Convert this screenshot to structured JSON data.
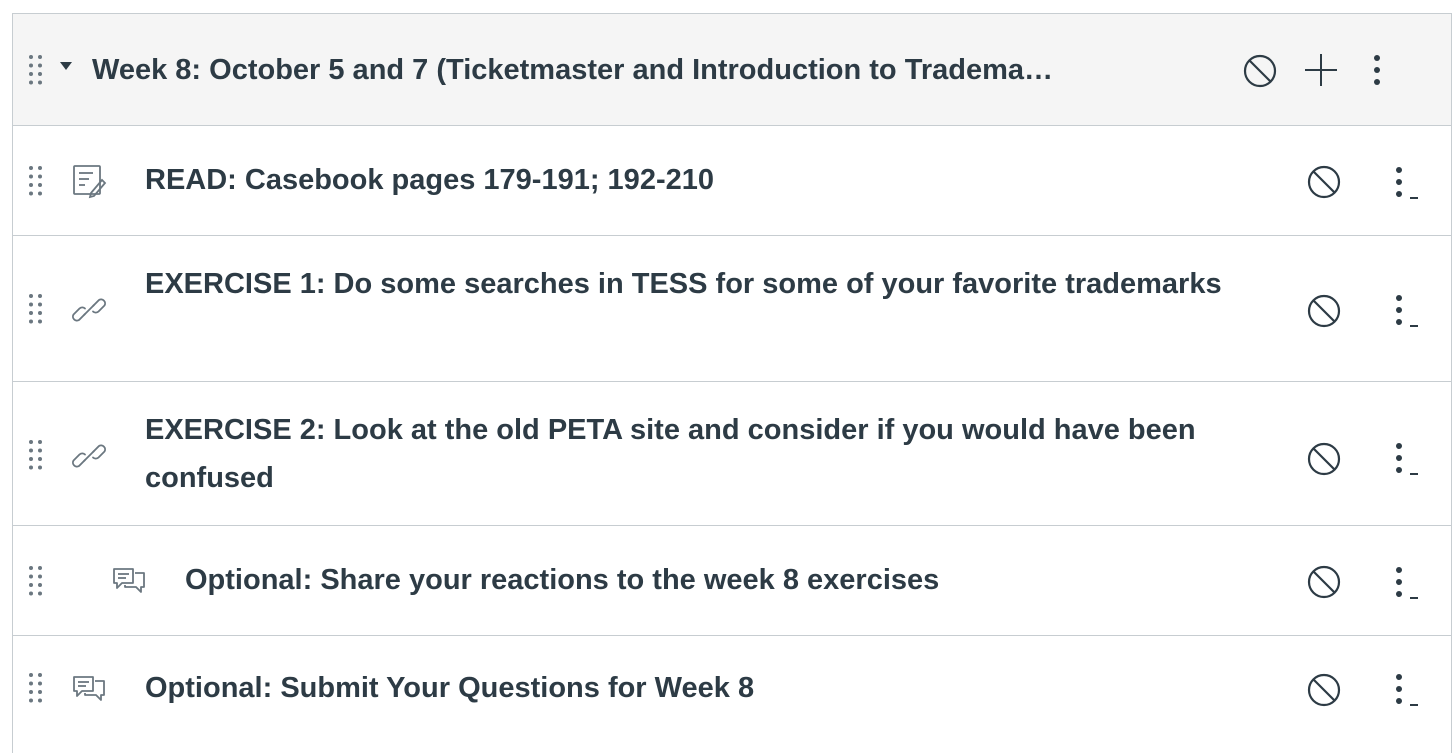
{
  "module": {
    "title": "Week 8: October 5 and 7 (Ticketmaster and Introduction to Tradema…"
  },
  "items": [
    {
      "title": "READ: Casebook pages 179-191; 192-210",
      "icon": "assignment-icon"
    },
    {
      "title": "EXERCISE 1: Do some searches in TESS for some of your favorite trademarks",
      "icon": "link-icon"
    },
    {
      "title": "EXERCISE 2: Look at the old PETA site and consider if you would have been confused",
      "icon": "link-icon"
    },
    {
      "title": "Optional: Share your reactions to the week 8 exercises",
      "icon": "discussion-icon"
    },
    {
      "title": "Optional: Submit Your Questions for Week 8",
      "icon": "discussion-icon"
    }
  ],
  "colors": {
    "text": "#2d3b45",
    "icon_gray": "#6b7780",
    "border": "#c7cdd1",
    "header_bg": "#f5f5f5"
  }
}
